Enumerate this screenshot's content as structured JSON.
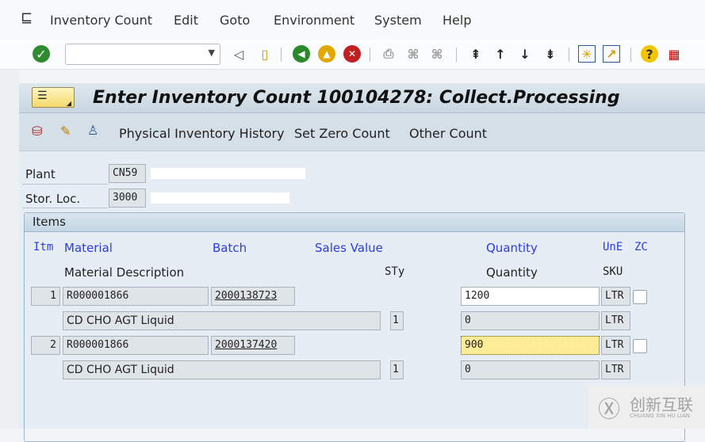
{
  "menu": {
    "items": [
      "Inventory Count",
      "Edit",
      "Goto",
      "Environment",
      "System",
      "Help"
    ]
  },
  "toolbar": {
    "command_value": ""
  },
  "title": "Enter Inventory Count 100104278: Collect.Processing",
  "app_toolbar": {
    "buttons": [
      "Physical Inventory History",
      "Set Zero Count",
      "Other Count"
    ]
  },
  "header": {
    "plant_label": "Plant",
    "plant_value": "CN59",
    "storloc_label": "Stor. Loc.",
    "storloc_value": "3000"
  },
  "items": {
    "title": "Items",
    "columns": {
      "itm": "Itm",
      "material": "Material",
      "batch": "Batch",
      "sales_value": "Sales Value",
      "quantity": "Quantity",
      "une": "UnE",
      "zc": "ZC",
      "material_description": "Material Description",
      "sty": "STy",
      "quantity2": "Quantity",
      "sku": "SKU"
    },
    "rows": [
      {
        "itm": "1",
        "material": "R000001866",
        "batch": "2000138723",
        "quantity": "1200",
        "une": "LTR",
        "description": "CD CHO AGT Liquid",
        "sty": "1",
        "sku_quantity": "0",
        "sku": "LTR"
      },
      {
        "itm": "2",
        "material": "R000001866",
        "batch": "2000137420",
        "quantity": "900",
        "une": "LTR",
        "description": "CD CHO AGT Liquid",
        "sty": "1",
        "sku_quantity": "0",
        "sku": "LTR"
      }
    ]
  },
  "watermark": {
    "text": "创新互联",
    "sub": "CHUANG XIN HU LIAN"
  }
}
